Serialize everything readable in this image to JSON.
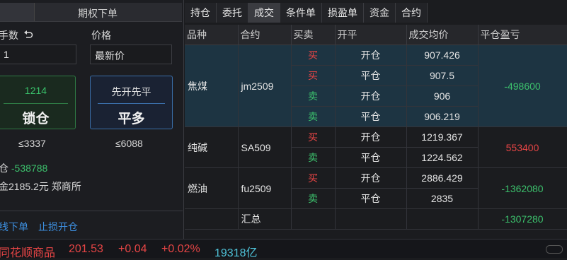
{
  "left": {
    "title": "期权下单",
    "qty_label": "手数",
    "price_label": "价格",
    "qty_value": "1",
    "price_value": "最新价",
    "btn_lock": {
      "top": "1214",
      "bottom": "锁仓"
    },
    "btn_open": {
      "top": "先开先平",
      "bottom": "平多"
    },
    "limit_left": "≤3337",
    "limit_right": "≤6088",
    "pos_label": "仓",
    "pos_value": "-538788",
    "margin_text": "金2185.2元 郑商所",
    "link1": "线下单",
    "link2": "止损开仓"
  },
  "tabs": [
    "持仓",
    "委托",
    "成交",
    "条件单",
    "损盈单",
    "资金",
    "合约"
  ],
  "table": {
    "headers": [
      "品种",
      "合约",
      "买卖",
      "开平",
      "成交均价",
      "平仓盈亏"
    ],
    "groups": [
      {
        "name": "焦煤",
        "code": "jm2509",
        "pnl": "-498600",
        "pnl_color": "#3cc06c",
        "rows": [
          {
            "side": "买",
            "oc": "开仓",
            "price": "907.426"
          },
          {
            "side": "买",
            "oc": "平仓",
            "price": "907.5"
          },
          {
            "side": "卖",
            "oc": "开仓",
            "price": "906"
          },
          {
            "side": "卖",
            "oc": "平仓",
            "price": "906.219"
          }
        ]
      },
      {
        "name": "纯碱",
        "code": "SA509",
        "pnl": "553400",
        "pnl_color": "#e64545",
        "rows": [
          {
            "side": "买",
            "oc": "开仓",
            "price": "1219.367"
          },
          {
            "side": "卖",
            "oc": "平仓",
            "price": "1224.562"
          }
        ]
      },
      {
        "name": "燃油",
        "code": "fu2509",
        "pnl": "-1362080",
        "pnl_color": "#3cc06c",
        "rows": [
          {
            "side": "买",
            "oc": "开仓",
            "price": "2886.429"
          },
          {
            "side": "卖",
            "oc": "平仓",
            "price": "2835"
          }
        ]
      }
    ],
    "total_label": "汇总",
    "total_value": "-1307280"
  },
  "status": {
    "name": "同花顺商品",
    "price": "201.53",
    "change": "+0.04",
    "pct": "+0.02%",
    "volume": "19318亿"
  }
}
